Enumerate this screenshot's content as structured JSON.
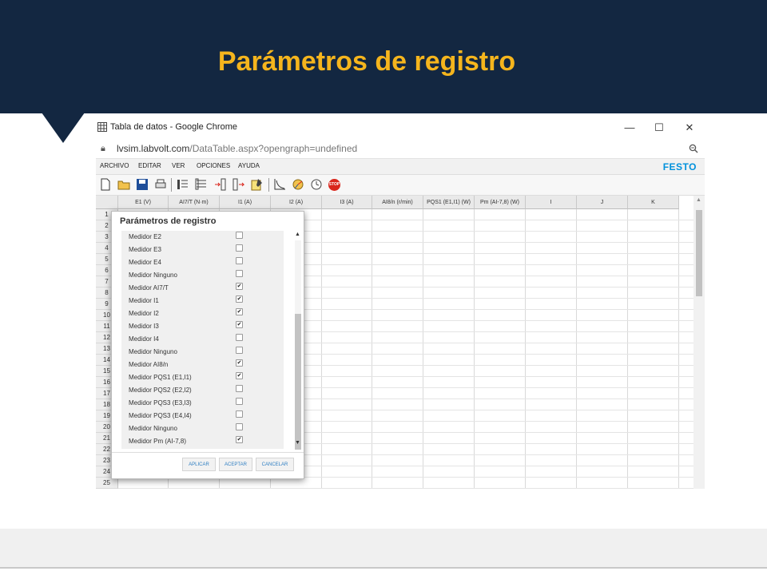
{
  "slide": {
    "title": "Parámetros de registro",
    "header_color": "#132741",
    "title_color": "#f5b51d"
  },
  "browser": {
    "window_title": "Tabla de datos - Google Chrome",
    "url_host": "lvsim.labvolt.com",
    "url_path": "/DataTable.aspx?opengraph=undefined",
    "minimize_glyph": "—",
    "maximize_glyph": "☐",
    "close_glyph": "✕"
  },
  "app": {
    "menu": [
      "ARCHIVO",
      "EDITAR",
      "VER",
      "OPCIONES",
      "AYUDA"
    ],
    "brand": "FESTO",
    "brand_color": "#0091dc",
    "toolbar_icons": [
      "new-file-icon",
      "open-folder-icon",
      "save-icon",
      "print-icon",
      "record-icon",
      "insert-row-icon",
      "insert-column-icon",
      "export-icon",
      "edit-icon",
      "graph-icon",
      "phasor-icon",
      "timer-icon",
      "stop-icon"
    ],
    "stop_label": "STOP"
  },
  "grid": {
    "columns": [
      "E1 (V)",
      "AI7/T (N·m)",
      "I1 (A)",
      "I2 (A)",
      "I3 (A)",
      "AI8/n (r/min)",
      "PQS1 (E1,I1) (W)",
      "Pm (AI-7,8) (W)",
      "I",
      "J",
      "K"
    ],
    "rows": [
      "1",
      "2",
      "3",
      "4",
      "5",
      "6",
      "7",
      "8",
      "9",
      "10",
      "11",
      "12",
      "13",
      "14",
      "15",
      "16",
      "17",
      "18",
      "19",
      "20",
      "21",
      "22",
      "23",
      "24",
      "25"
    ]
  },
  "dialog": {
    "title": "Parámetros de registro",
    "items": [
      {
        "label": "Medidor E2",
        "checked": false
      },
      {
        "label": "Medidor E3",
        "checked": false
      },
      {
        "label": "Medidor E4",
        "checked": false
      },
      {
        "label": "Medidor Ninguno",
        "checked": false
      },
      {
        "label": "Medidor AI7/T",
        "checked": true
      },
      {
        "label": "Medidor I1",
        "checked": true
      },
      {
        "label": "Medidor I2",
        "checked": true
      },
      {
        "label": "Medidor I3",
        "checked": true
      },
      {
        "label": "Medidor I4",
        "checked": false
      },
      {
        "label": "Medidor Ninguno",
        "checked": false
      },
      {
        "label": "Medidor AI8/n",
        "checked": true
      },
      {
        "label": "Medidor PQS1 (E1,I1)",
        "checked": true
      },
      {
        "label": "Medidor PQS2 (E2,I2)",
        "checked": false
      },
      {
        "label": "Medidor PQS3 (E3,I3)",
        "checked": false
      },
      {
        "label": "Medidor PQS3 (E4,I4)",
        "checked": false
      },
      {
        "label": "Medidor Ninguno",
        "checked": false
      },
      {
        "label": "Medidor Pm (AI-7,8)",
        "checked": true
      }
    ],
    "buttons": {
      "apply": "APLICAR",
      "accept": "ACEPTAR",
      "cancel": "CANCELAR"
    }
  }
}
